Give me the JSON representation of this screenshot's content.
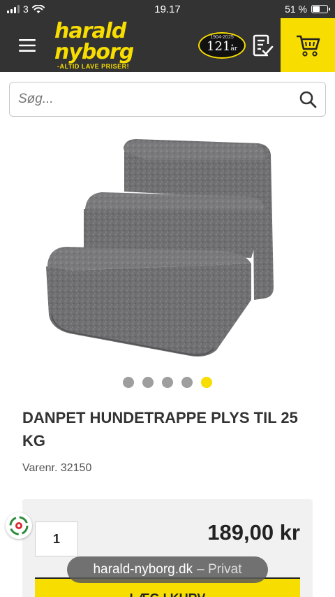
{
  "status_bar": {
    "carrier": "3",
    "time": "19.17",
    "battery_text": "51 %",
    "battery_level": 0.51
  },
  "header": {
    "menu_icon": "hamburger-icon",
    "brand_name": "harald nyborg",
    "brand_slogan": "-ALTID LAVE PRISER!",
    "anniversary_years": "1904-2025",
    "anniversary_number": "121",
    "anniversary_unit": "år",
    "list_icon": "checklist-icon",
    "cart_icon": "cart-icon",
    "accent_color": "#f7dd00"
  },
  "search": {
    "placeholder": "Søg...",
    "icon": "search-icon"
  },
  "gallery": {
    "image_alt": "grey plush dog stairs",
    "dots_total": 5,
    "active_index": 4
  },
  "product": {
    "title": "DANPET HUNDETRAPPE PLYS TIL 25 KG",
    "sku_label": "Varenr.",
    "sku": "32150",
    "quantity": "1",
    "price": "189,00 kr",
    "add_to_cart_label": "LÆG I KURV"
  },
  "browser": {
    "url": "harald-nyborg.dk",
    "separator": "–",
    "mode": "Privat"
  }
}
